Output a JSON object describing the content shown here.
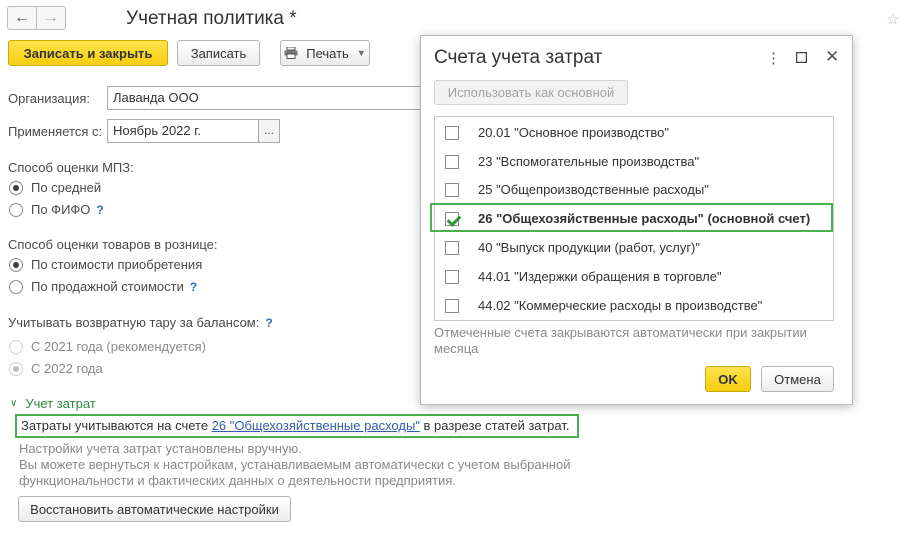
{
  "window": {
    "title": "Учетная политика *",
    "back_icon": "arrow-left-icon",
    "forward_icon": "arrow-right-icon",
    "star_icon": "star-icon"
  },
  "toolbar": {
    "save_close_label": "Записать и закрыть",
    "save_label": "Записать",
    "print_label": "Печать"
  },
  "form": {
    "org_label": "Организация:",
    "org_value": "Лаванда ООО",
    "applies_label": "Применяется с:",
    "applies_value": "Ноябрь 2022 г.",
    "applies_select": "...",
    "mpz_label": "Способ оценки МПЗ:",
    "mpz_options": [
      {
        "label": "По средней",
        "checked": true
      },
      {
        "label": "По ФИФО",
        "checked": false,
        "help": "?"
      }
    ],
    "retail_label": "Способ оценки товаров в рознице:",
    "retail_options": [
      {
        "label": "По стоимости приобретения",
        "checked": true
      },
      {
        "label": "По продажной стоимости",
        "checked": false,
        "help": "?"
      }
    ],
    "tare_label": "Учитывать возвратную тару за балансом:",
    "tare_help": "?",
    "tare_options": [
      {
        "label": "С 2021 года (рекомендуется)",
        "checked": false
      },
      {
        "label": "С 2022 года",
        "checked": true
      }
    ],
    "cost_group_label": "Учет затрат",
    "cost_text_before": "Затраты учитываются на счете ",
    "cost_link": "26 \"Общехозяйственные расходы\"",
    "cost_text_after": " в разрезе статей затрат.",
    "manual_note_1": "Настройки учета затрат установлены вручную.",
    "manual_note_2": "Вы можете вернуться к настройкам, устанавливаемым автоматически с учетом выбранной",
    "manual_note_3": "функциональности и фактических данных о деятельности предприятия.",
    "restore_button": "Восстановить автоматические настройки"
  },
  "dialog": {
    "title": "Счета учета затрат",
    "more_icon": "more-vertical-icon",
    "maximize_icon": "maximize-icon",
    "close_icon": "close-icon",
    "use_main_button": "Использовать как основной",
    "accounts": [
      {
        "label": "20.01 \"Основное производство\"",
        "checked": false
      },
      {
        "label": "23 \"Вспомогательные производства\"",
        "checked": false
      },
      {
        "label": "25 \"Общепроизводственные расходы\"",
        "checked": false
      },
      {
        "label": "26 \"Общехозяйственные расходы\" (основной счет)",
        "checked": true
      },
      {
        "label": "40 \"Выпуск продукции (работ, услуг)\"",
        "checked": false
      },
      {
        "label": "44.01 \"Издержки обращения в торговле\"",
        "checked": false
      },
      {
        "label": "44.02 \"Коммерческие расходы в производстве\"",
        "checked": false
      }
    ],
    "note_line_1": "Отмеченные счета закрываются автоматически при закрытии",
    "note_line_2": "месяца",
    "ok_button": "OK",
    "cancel_button": "Отмена"
  },
  "colors": {
    "accent_yellow": "#f6cd0e",
    "highlight_green": "#4caf50",
    "link_blue": "#2f5fa8",
    "group_green": "#2c8a3b"
  }
}
